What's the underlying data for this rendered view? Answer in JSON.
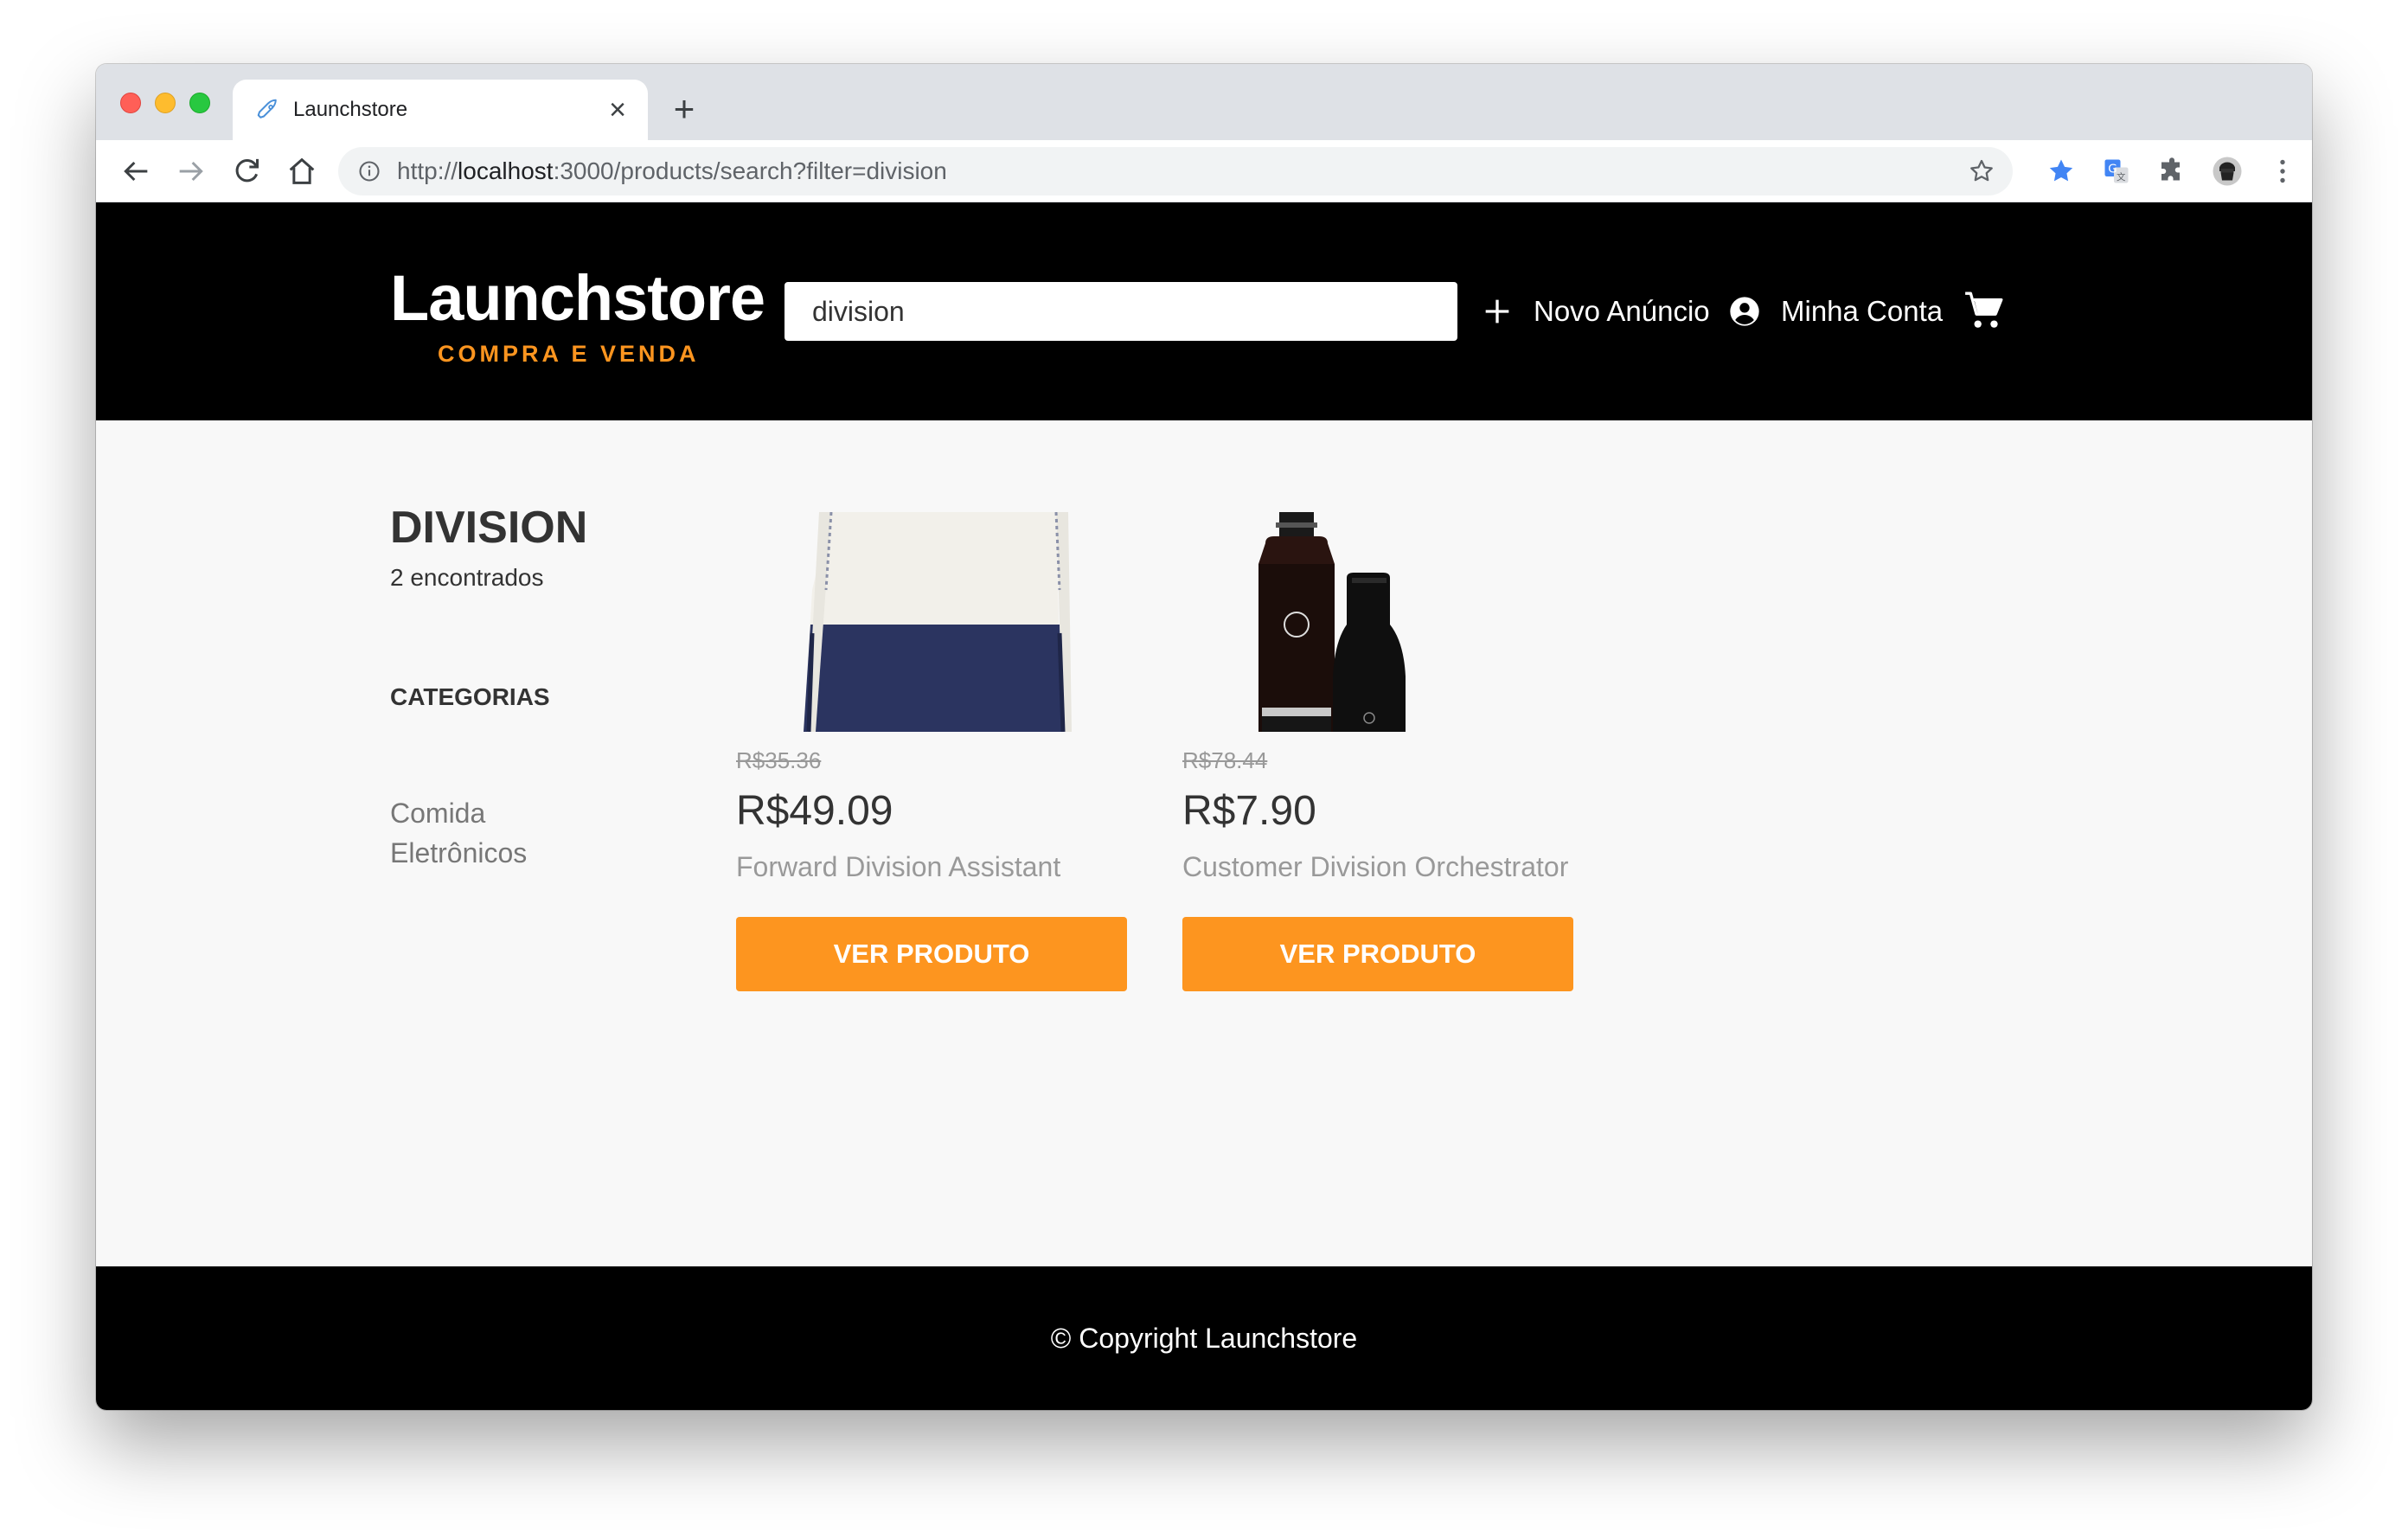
{
  "browser": {
    "tab_title": "Launchstore",
    "url_scheme": "http://",
    "url_host": "localhost",
    "url_rest": ":3000/products/search?filter=division"
  },
  "header": {
    "logo_title": "Launchstore",
    "logo_subtitle": "COMPRA E VENDA",
    "search_value": "division",
    "new_ad_label": "Novo Anúncio",
    "account_label": "Minha Conta"
  },
  "results": {
    "title": "DIVISION",
    "count_text": "2 encontrados"
  },
  "categories": {
    "heading": "CATEGORIAS",
    "items": [
      "Comida",
      "Eletrônicos"
    ]
  },
  "products": [
    {
      "old_price": "R$35.36",
      "price": "R$49.09",
      "name": "Forward Division Assistant",
      "button_label": "VER PRODUTO",
      "image": "sweater-photo"
    },
    {
      "old_price": "R$78.44",
      "price": "R$7.90",
      "name": "Customer Division Orchestrator",
      "button_label": "VER PRODUTO",
      "image": "cosmetic-bottles-photo"
    }
  ],
  "footer": {
    "text": "© Copyright Launchstore"
  },
  "colors": {
    "accent": "#fd951f",
    "header_bg": "#000000",
    "page_bg": "#f8f8f8"
  }
}
